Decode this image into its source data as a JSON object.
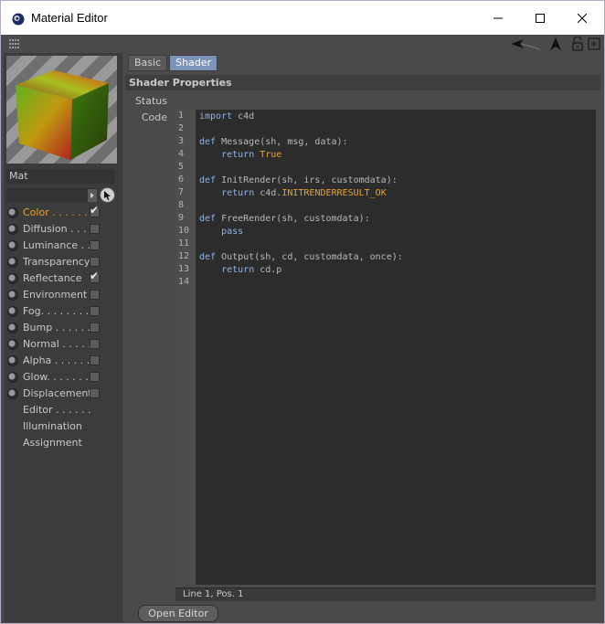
{
  "window": {
    "title": "Material Editor",
    "icons": [
      "cinema4d-icon",
      "minimize-icon",
      "maximize-icon",
      "close-icon"
    ]
  },
  "toolbar": {
    "icons": [
      "grip-icon",
      "back-arrow-icon",
      "navigate-up-icon",
      "lock-icon",
      "new-window-icon"
    ]
  },
  "material": {
    "name": "Mat",
    "search_value": ""
  },
  "channels": [
    {
      "label": "Color . . . . . . .",
      "checked": true,
      "active": true,
      "has_radio": true,
      "has_check": true
    },
    {
      "label": "Diffusion . . .",
      "checked": false,
      "active": false,
      "has_radio": true,
      "has_check": true
    },
    {
      "label": "Luminance . .",
      "checked": false,
      "active": false,
      "has_radio": true,
      "has_check": true
    },
    {
      "label": "Transparency",
      "checked": false,
      "active": false,
      "has_radio": true,
      "has_check": true
    },
    {
      "label": "Reflectance",
      "checked": true,
      "active": false,
      "has_radio": true,
      "has_check": true
    },
    {
      "label": "Environment",
      "checked": false,
      "active": false,
      "has_radio": true,
      "has_check": true
    },
    {
      "label": "Fog. . . . . . . .",
      "checked": false,
      "active": false,
      "has_radio": true,
      "has_check": true
    },
    {
      "label": "Bump . . . . . .",
      "checked": false,
      "active": false,
      "has_radio": true,
      "has_check": true
    },
    {
      "label": "Normal . . . . .",
      "checked": false,
      "active": false,
      "has_radio": true,
      "has_check": true
    },
    {
      "label": "Alpha . . . . . .",
      "checked": false,
      "active": false,
      "has_radio": true,
      "has_check": true
    },
    {
      "label": "Glow. . . . . . .",
      "checked": false,
      "active": false,
      "has_radio": true,
      "has_check": true
    },
    {
      "label": "Displacement",
      "checked": false,
      "active": false,
      "has_radio": true,
      "has_check": true
    },
    {
      "label": "Editor . . . . . .",
      "checked": false,
      "active": false,
      "has_radio": false,
      "has_check": false
    },
    {
      "label": "Illumination",
      "checked": false,
      "active": false,
      "has_radio": false,
      "has_check": false
    },
    {
      "label": "Assignment",
      "checked": false,
      "active": false,
      "has_radio": false,
      "has_check": false
    }
  ],
  "tabs": [
    {
      "label": "Basic",
      "active": false
    },
    {
      "label": "Shader",
      "active": true
    }
  ],
  "section": {
    "title": "Shader Properties",
    "status_label": "Status",
    "code_label": "Code"
  },
  "code": {
    "lines": [
      [
        [
          "kw",
          "import"
        ],
        [
          "t",
          " c4d"
        ]
      ],
      [],
      [
        [
          "kw",
          "def"
        ],
        [
          "t",
          " Message(sh, msg, data):"
        ]
      ],
      [
        [
          "t",
          "    "
        ],
        [
          "kw",
          "return"
        ],
        [
          "t",
          " "
        ],
        [
          "const",
          "True"
        ]
      ],
      [],
      [
        [
          "kw",
          "def"
        ],
        [
          "t",
          " InitRender(sh, irs, customdata):"
        ]
      ],
      [
        [
          "t",
          "    "
        ],
        [
          "kw",
          "return"
        ],
        [
          "t",
          " c4d."
        ],
        [
          "const",
          "INITRENDERRESULT_OK"
        ]
      ],
      [],
      [
        [
          "kw",
          "def"
        ],
        [
          "t",
          " FreeRender(sh, customdata):"
        ]
      ],
      [
        [
          "t",
          "    "
        ],
        [
          "kw",
          "pass"
        ]
      ],
      [],
      [
        [
          "kw",
          "def"
        ],
        [
          "t",
          " Output(sh, cd, customdata, once):"
        ]
      ],
      [
        [
          "t",
          "    "
        ],
        [
          "kw",
          "return"
        ],
        [
          "t",
          " cd.p"
        ]
      ],
      []
    ],
    "line_numbers": [
      "1",
      "2",
      "3",
      "4",
      "5",
      "6",
      "7",
      "8",
      "9",
      "10",
      "11",
      "12",
      "13",
      "14"
    ]
  },
  "status_bar": {
    "text": "Line 1, Pos. 1"
  },
  "buttons": {
    "open_editor": "Open Editor"
  },
  "colors": {
    "accent": "#f0a020",
    "keyword": "#8fb3e8",
    "tab_active": "#7b93b8"
  }
}
